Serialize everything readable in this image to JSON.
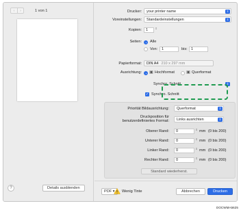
{
  "preview": {
    "page_indicator": "1 von 1",
    "prev_icon": "chevron-left-icon",
    "next_icon": "chevron-right-icon"
  },
  "left_footer": {
    "help_label": "?",
    "hide_details_label": "Details ausblenden"
  },
  "settings": {
    "printer_label": "Drucker:",
    "printer_value": "your printer name",
    "presets_label": "Voreinstellungen:",
    "presets_value": "Standardeinstellungen",
    "copies_label": "Kopien:",
    "copies_value": "1",
    "pages_label": "Seiten:",
    "pages_all_label": "Alle",
    "pages_from_label": "Von:",
    "pages_from_value": "1",
    "pages_to_label": "bis:",
    "pages_to_value": "1",
    "paper_label": "Papierformat:",
    "paper_value": "DIN A4",
    "paper_size": "210 x 297 mm",
    "orientation_label": "Ausrichtung:",
    "portrait_label": "Hochformat",
    "landscape_label": "Querformat",
    "section_value": "Synchro. Schnitt"
  },
  "synchro": {
    "checkbox_label": "Synchro. Schnitt",
    "checked": true,
    "highlight_color": "#1e9b4f"
  },
  "panel": {
    "priority_label": "Priorität Bildausrichtung:",
    "priority_value": "Querformat",
    "position_label_line1": "Druckposition für",
    "position_label_line2": "benutzerdefiniertes Format:",
    "position_value": "Links ausrichten",
    "margins": [
      {
        "label": "Oberer Rand:",
        "value": "0",
        "unit": "mm",
        "range": "(0 bis 200)"
      },
      {
        "label": "Unterer Rand:",
        "value": "0",
        "unit": "mm",
        "range": "(0 bis 200)"
      },
      {
        "label": "Linker Rand:",
        "value": "0",
        "unit": "mm",
        "range": "(0 bis 200)"
      },
      {
        "label": "Rechter Rand:",
        "value": "0",
        "unit": "mm",
        "range": "(0 bis 200)"
      }
    ],
    "restore_label": "Standard wiederherst."
  },
  "footer": {
    "pdf_label": "PDF",
    "warning_text": "Wenig Tinte",
    "cancel_label": "Abbrechen",
    "print_label": "Drucken"
  },
  "image_code": "DOCWMA5625",
  "colors": {
    "accent": "#2d6de6",
    "warning": "#f2c12e",
    "dialog_bg": "#ececec"
  }
}
